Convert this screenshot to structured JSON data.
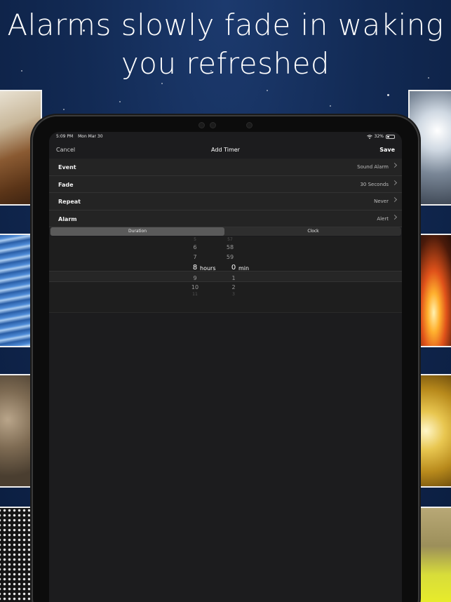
{
  "headline": {
    "line1": "Alarms slowly fade in waking",
    "line2": "you refreshed"
  },
  "status_bar": {
    "time": "5:09 PM",
    "date": "Mon Mar 30",
    "battery": "32%",
    "wifi_icon": "wifi-icon",
    "battery_icon": "battery-icon"
  },
  "nav": {
    "cancel": "Cancel",
    "title": "Add Timer",
    "save": "Save"
  },
  "settings": [
    {
      "label": "Event",
      "value": "Sound Alarm"
    },
    {
      "label": "Fade",
      "value": "30 Seconds"
    },
    {
      "label": "Repeat",
      "value": "Never"
    },
    {
      "label": "Alarm",
      "value": "Alert"
    }
  ],
  "mode_segment": {
    "options": [
      "Duration",
      "Clock"
    ],
    "selected": "Duration"
  },
  "picker": {
    "hours_column": [
      "5",
      "6",
      "7",
      "8",
      "9",
      "10",
      "11"
    ],
    "minutes_column": [
      "57",
      "58",
      "59",
      "0",
      "1",
      "2",
      "3"
    ],
    "selected_hours": "8",
    "selected_minutes": "0",
    "hours_unit": "hours",
    "minutes_unit": "min"
  }
}
